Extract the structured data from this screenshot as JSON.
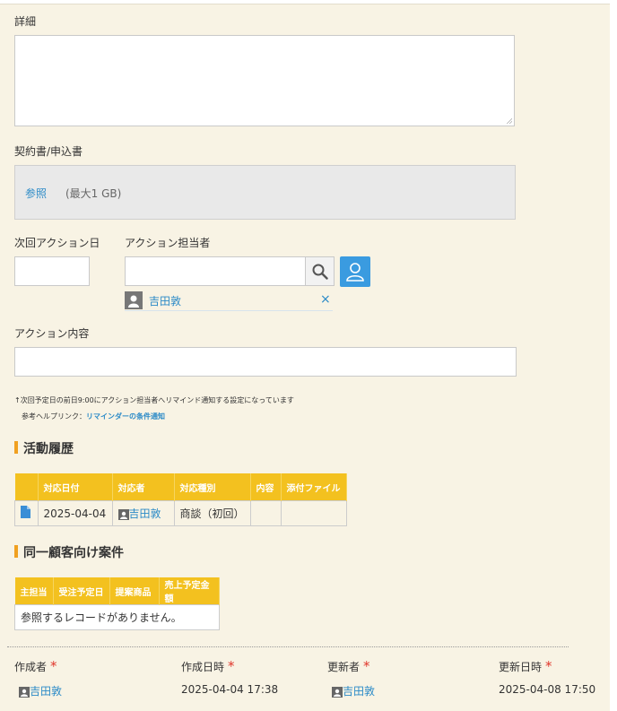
{
  "details": {
    "label": "詳細",
    "value": ""
  },
  "contract": {
    "label": "契約書/申込書",
    "browse": "参照",
    "max_size": "(最大1 GB)"
  },
  "next_action_date": {
    "label": "次回アクション日",
    "value": ""
  },
  "action_owner": {
    "label": "アクション担当者",
    "search_value": "",
    "selected_user": "吉田敦",
    "remove_symbol": "×"
  },
  "action_content": {
    "label": "アクション内容",
    "value": ""
  },
  "reminder": {
    "note": "↑次回予定日の前日9:00にアクション担当者へリマインド通知する設定になっています",
    "help_prefix": "参考ヘルプリンク：",
    "help_link": "リマインダーの条件通知"
  },
  "activity_history": {
    "title": "活動履歴",
    "columns": [
      "",
      "対応日付",
      "対応者",
      "対応種別",
      "内容",
      "添付ファイル"
    ],
    "rows": [
      {
        "date": "2025-04-04",
        "person": "吉田敦",
        "type": "商談（初回）",
        "content": "",
        "attachment": ""
      }
    ]
  },
  "same_customer": {
    "title": "同一顧客向け案件",
    "columns": [
      "主担当",
      "受注予定日",
      "提案商品",
      "売上予定金額"
    ],
    "empty": "参照するレコードがありません。"
  },
  "footer": {
    "created_by_label": "作成者",
    "created_at_label": "作成日時",
    "updated_by_label": "更新者",
    "updated_at_label": "更新日時",
    "required_mark": "*",
    "created_by": "吉田敦",
    "created_at": "2025-04-04 17:38",
    "updated_by": "吉田敦",
    "updated_at": "2025-04-08 17:50"
  },
  "colors": {
    "header": "#f3c11f",
    "accent": "#f0a020",
    "link": "#2a8ac7",
    "user_button": "#3a9be0"
  }
}
